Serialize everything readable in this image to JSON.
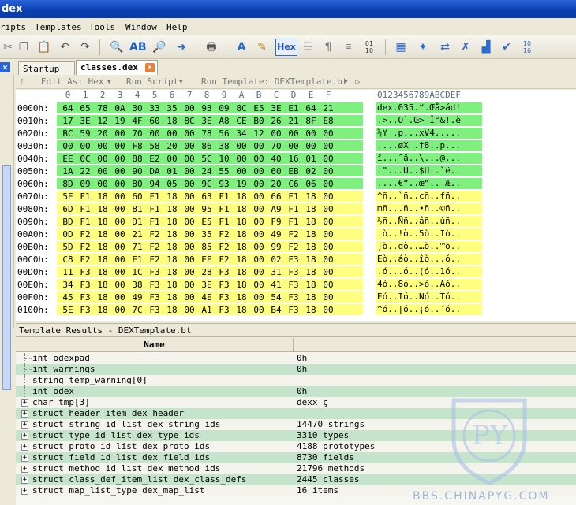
{
  "window": {
    "title": "dex"
  },
  "menu": [
    "ripts",
    "Templates",
    "Tools",
    "Window",
    "Help"
  ],
  "toolbar": {
    "hex_label": "Hex"
  },
  "tabs": [
    {
      "label": "Startup"
    },
    {
      "label": "classes.dex"
    }
  ],
  "editor_bar": {
    "edit_as": "Edit As: Hex",
    "run_script": "Run Script",
    "run_template": "Run Template: DEXTemplate.bt"
  },
  "hex": {
    "columns": [
      "0",
      "1",
      "2",
      "3",
      "4",
      "5",
      "6",
      "7",
      "8",
      "9",
      "A",
      "B",
      "C",
      "D",
      "E",
      "F"
    ],
    "ascii_header": "0123456789ABCDEF",
    "colors": {
      "green": "#7ff07f",
      "yellow": "#ffff80",
      "white": "#ffffff"
    },
    "rows": [
      {
        "addr": "0000h:",
        "bytes": [
          "64",
          "65",
          "78",
          "0A",
          "30",
          "33",
          "35",
          "00",
          "93",
          "09",
          "8C",
          "E5",
          "3E",
          "E1",
          "64",
          "21"
        ],
        "ascii": "dex.035.“.Œå>ád!",
        "color": "green"
      },
      {
        "addr": "0010h:",
        "bytes": [
          "17",
          "3E",
          "12",
          "19",
          "4F",
          "60",
          "18",
          "8C",
          "3E",
          "A8",
          "CE",
          "B0",
          "26",
          "21",
          "8F",
          "E8"
        ],
        "ascii": ".>..O`.Œ>¨Î°&!.è",
        "color": "green"
      },
      {
        "addr": "0020h:",
        "bytes": [
          "BC",
          "59",
          "20",
          "00",
          "70",
          "00",
          "00",
          "00",
          "78",
          "56",
          "34",
          "12",
          "00",
          "00",
          "00",
          "00"
        ],
        "ascii": "¼Y .p...xV4.....",
        "color": "green"
      },
      {
        "addr": "0030h:",
        "bytes": [
          "00",
          "00",
          "00",
          "00",
          "F8",
          "58",
          "20",
          "00",
          "86",
          "38",
          "00",
          "00",
          "70",
          "00",
          "00",
          "00"
        ],
        "ascii": "....øX .†8..p...",
        "color": "green"
      },
      {
        "addr": "0040h:",
        "bytes": [
          "EE",
          "0C",
          "00",
          "00",
          "88",
          "E2",
          "00",
          "00",
          "5C",
          "10",
          "00",
          "00",
          "40",
          "16",
          "01",
          "00"
        ],
        "ascii": "î...ˆâ..\\...@...",
        "color": "green"
      },
      {
        "addr": "0050h:",
        "bytes": [
          "1A",
          "22",
          "00",
          "00",
          "90",
          "DA",
          "01",
          "00",
          "24",
          "55",
          "00",
          "00",
          "60",
          "EB",
          "02",
          "00"
        ],
        "ascii": ".\"...Ú..$U..`ë..",
        "color": "green"
      },
      {
        "addr": "0060h:",
        "bytes": [
          "8D",
          "09",
          "00",
          "00",
          "80",
          "94",
          "05",
          "00",
          "9C",
          "93",
          "19",
          "00",
          "20",
          "C6",
          "06",
          "00"
        ],
        "ascii": "....€”..œ“.. Æ..",
        "color": "green"
      },
      {
        "addr": "0070h:",
        "bytes": [
          "5E",
          "F1",
          "18",
          "00",
          "60",
          "F1",
          "18",
          "00",
          "63",
          "F1",
          "18",
          "00",
          "66",
          "F1",
          "18",
          "00"
        ],
        "ascii": "^ñ..`ñ..cñ..fñ..",
        "color": "yellow"
      },
      {
        "addr": "0080h:",
        "bytes": [
          "6D",
          "F1",
          "18",
          "00",
          "81",
          "F1",
          "18",
          "00",
          "95",
          "F1",
          "18",
          "00",
          "A9",
          "F1",
          "18",
          "00"
        ],
        "ascii": "mñ...ñ..•ñ..©ñ..",
        "color": "yellow"
      },
      {
        "addr": "0090h:",
        "bytes": [
          "BD",
          "F1",
          "18",
          "00",
          "D1",
          "F1",
          "18",
          "00",
          "E5",
          "F1",
          "18",
          "00",
          "F9",
          "F1",
          "18",
          "00"
        ],
        "ascii": "½ñ..Ññ..åñ..ùñ..",
        "color": "yellow"
      },
      {
        "addr": "00A0h:",
        "bytes": [
          "0D",
          "F2",
          "18",
          "00",
          "21",
          "F2",
          "18",
          "00",
          "35",
          "F2",
          "18",
          "00",
          "49",
          "F2",
          "18",
          "00"
        ],
        "ascii": ".ò..!ò..5ò..Iò..",
        "color": "yellow"
      },
      {
        "addr": "00B0h:",
        "bytes": [
          "5D",
          "F2",
          "18",
          "00",
          "71",
          "F2",
          "18",
          "00",
          "85",
          "F2",
          "18",
          "00",
          "99",
          "F2",
          "18",
          "00"
        ],
        "ascii": "]ò..qò..…ò..™ò..",
        "color": "yellow"
      },
      {
        "addr": "00C0h:",
        "bytes": [
          "C8",
          "F2",
          "18",
          "00",
          "E1",
          "F2",
          "18",
          "00",
          "EE",
          "F2",
          "18",
          "00",
          "02",
          "F3",
          "18",
          "00"
        ],
        "ascii": "Èò..áò..îò...ó..",
        "color": "yellow"
      },
      {
        "addr": "00D0h:",
        "bytes": [
          "11",
          "F3",
          "18",
          "00",
          "1C",
          "F3",
          "18",
          "00",
          "28",
          "F3",
          "18",
          "00",
          "31",
          "F3",
          "18",
          "00"
        ],
        "ascii": ".ó...ó..(ó..1ó..",
        "color": "yellow"
      },
      {
        "addr": "00E0h:",
        "bytes": [
          "34",
          "F3",
          "18",
          "00",
          "38",
          "F3",
          "18",
          "00",
          "3E",
          "F3",
          "18",
          "00",
          "41",
          "F3",
          "18",
          "00"
        ],
        "ascii": "4ó..8ó..>ó..Aó..",
        "color": "yellow"
      },
      {
        "addr": "00F0h:",
        "bytes": [
          "45",
          "F3",
          "18",
          "00",
          "49",
          "F3",
          "18",
          "00",
          "4E",
          "F3",
          "18",
          "00",
          "54",
          "F3",
          "18",
          "00"
        ],
        "ascii": "Eó..Ió..Nó..Tó..",
        "color": "yellow"
      },
      {
        "addr": "0100h:",
        "bytes": [
          "5E",
          "F3",
          "18",
          "00",
          "7C",
          "F3",
          "18",
          "00",
          "A1",
          "F3",
          "18",
          "00",
          "B4",
          "F3",
          "18",
          "00"
        ],
        "ascii": "^ó..|ó..¡ó..´ó..",
        "color": "yellow"
      }
    ]
  },
  "template_results": {
    "title": "Template Results - DEXTemplate.bt",
    "name_header": "Name",
    "rows": [
      {
        "name": "int odexpad",
        "value": "0h",
        "expandable": false
      },
      {
        "name": "int warnings",
        "value": "0h",
        "expandable": false
      },
      {
        "name": "string temp_warning[0]",
        "value": "",
        "expandable": false
      },
      {
        "name": "int odex",
        "value": "0h",
        "expandable": false
      },
      {
        "name": "char tmp[3]",
        "value": "dexx  ç",
        "expandable": true
      },
      {
        "name": "struct header_item dex_header",
        "value": "",
        "expandable": true
      },
      {
        "name": "struct string_id_list dex_string_ids",
        "value": "14470 strings",
        "expandable": true
      },
      {
        "name": "struct type_id_list dex_type_ids",
        "value": "3310 types",
        "expandable": true
      },
      {
        "name": "struct proto_id_list dex_proto_ids",
        "value": "4188 prototypes",
        "expandable": true
      },
      {
        "name": "struct field_id_list dex_field_ids",
        "value": "8730 fields",
        "expandable": true
      },
      {
        "name": "struct method_id_list dex_method_ids",
        "value": "21796 methods",
        "expandable": true
      },
      {
        "name": "struct class_def_item_list dex_class_defs",
        "value": "2445 classes",
        "expandable": true
      },
      {
        "name": "struct map_list_type dex_map_list",
        "value": "16 items",
        "expandable": true
      }
    ],
    "row_colors": [
      "#f4f4ec",
      "#c6e4cc"
    ]
  },
  "watermark": {
    "letters": "PY",
    "site": "BBS.CHINAPYG.COM"
  }
}
